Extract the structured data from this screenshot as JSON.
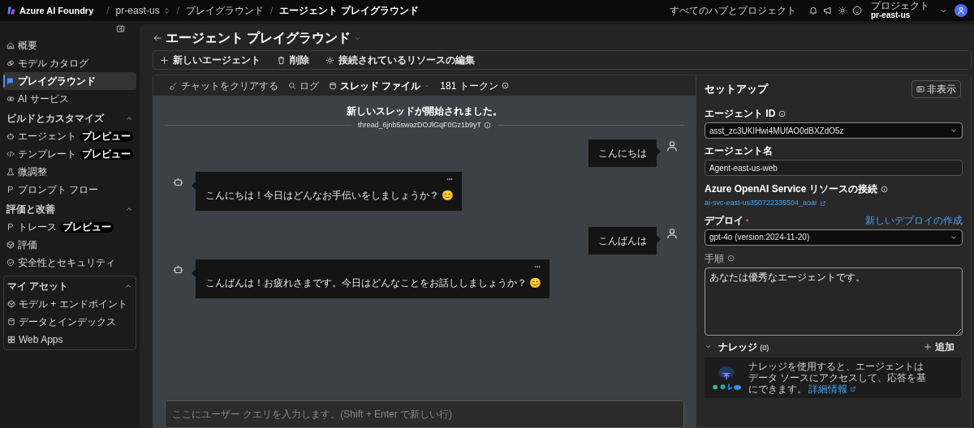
{
  "topbar": {
    "brand": "Azure AI Foundry",
    "separator": "/",
    "breadcrumbs": [
      {
        "label": "pr-east-us",
        "kind": "switcher"
      },
      {
        "label": "プレイグラウンド",
        "kind": "link"
      },
      {
        "label": "エージェント プレイグラウンド",
        "kind": "current"
      }
    ],
    "all_hubs": "すべてのハブとプロジェクト",
    "project_label": "プロジェクト",
    "project_name": "pr-east-us"
  },
  "sidebar": {
    "items": [
      {
        "label": "概要",
        "selected": false
      },
      {
        "label": "モデル カタログ",
        "selected": false
      },
      {
        "label": "プレイグラウンド",
        "selected": true
      },
      {
        "label": "AI サービス",
        "selected": false
      }
    ],
    "sections": [
      {
        "title": "ビルドとカスタマイズ",
        "expanded": true,
        "kind": "plain",
        "items": [
          {
            "label": "エージェント",
            "badge": "プレビュー"
          },
          {
            "label": "テンプレート",
            "badge": "プレビュー"
          },
          {
            "label": "微調整"
          },
          {
            "label": "プロンプト フロー"
          }
        ]
      },
      {
        "title": "評価と改善",
        "expanded": true,
        "kind": "plain",
        "items": [
          {
            "label": "トレース",
            "badge": "プレビュー"
          },
          {
            "label": "評価"
          },
          {
            "label": "安全性とセキュリティ"
          }
        ]
      },
      {
        "title": "マイ アセット",
        "expanded": true,
        "kind": "card",
        "items": [
          {
            "label": "モデル + エンドポイント"
          },
          {
            "label": "データとインデックス"
          },
          {
            "label": "Web Apps"
          }
        ]
      }
    ]
  },
  "page": {
    "title": "エージェント プレイグラウンド",
    "actions": [
      "新しいエージェント",
      "削除",
      "接続されているリソースの編集"
    ]
  },
  "chat": {
    "toolbar": {
      "clear": "チャットをクリアする",
      "log": "ログ",
      "thread_files": "スレッド ファイル",
      "tokens": "181 トークン"
    },
    "thread_notice": "新しいスレッドが開始されました。",
    "thread_id": "thread_6jnb5swazDOJlGqF0Gz1b9yT",
    "messages": [
      {
        "kind": "user",
        "text": "こんにちは"
      },
      {
        "kind": "agent",
        "text": "こんにちは！今日はどんなお手伝いをしましょうか？ 😊"
      },
      {
        "kind": "user",
        "text": "こんばんは"
      },
      {
        "kind": "agent",
        "text": "こんばんは！お疲れさまです。今日はどんなことをお話ししましょうか？ 😊"
      }
    ],
    "input_placeholder": "ここにユーザー クエリを入力します。(Shift + Enter で新しい行)"
  },
  "setup": {
    "title": "セットアップ",
    "hide_button": "非表示",
    "agent_id_label": "エージェント ID",
    "agent_id": "asst_zc3UKIHwi4MUfAO0dBXZdO5z",
    "agent_name_label": "エージェント名",
    "agent_name": "Agent-east-us-web",
    "connection_label": "Azure OpenAI Service リソースの接続",
    "connection_link": "ai-svc-east-us350722335504_aoai",
    "deploy_label": "デプロイ",
    "deploy_required": true,
    "new_deploy_link": "新しいデプロイの作成",
    "deployment": "gpt-4o (version:2024-11-20)",
    "instructions_label": "手順",
    "instructions": "あなたは優秀なエージェントです。",
    "knowledge": {
      "title": "ナレッジ",
      "count": "(0)",
      "expanded": true,
      "add": "追加",
      "description": "ナレッジを使用すると、エージェントはデータ ソースにアクセスして、応答を基にできます。",
      "link": "詳細情報"
    }
  }
}
